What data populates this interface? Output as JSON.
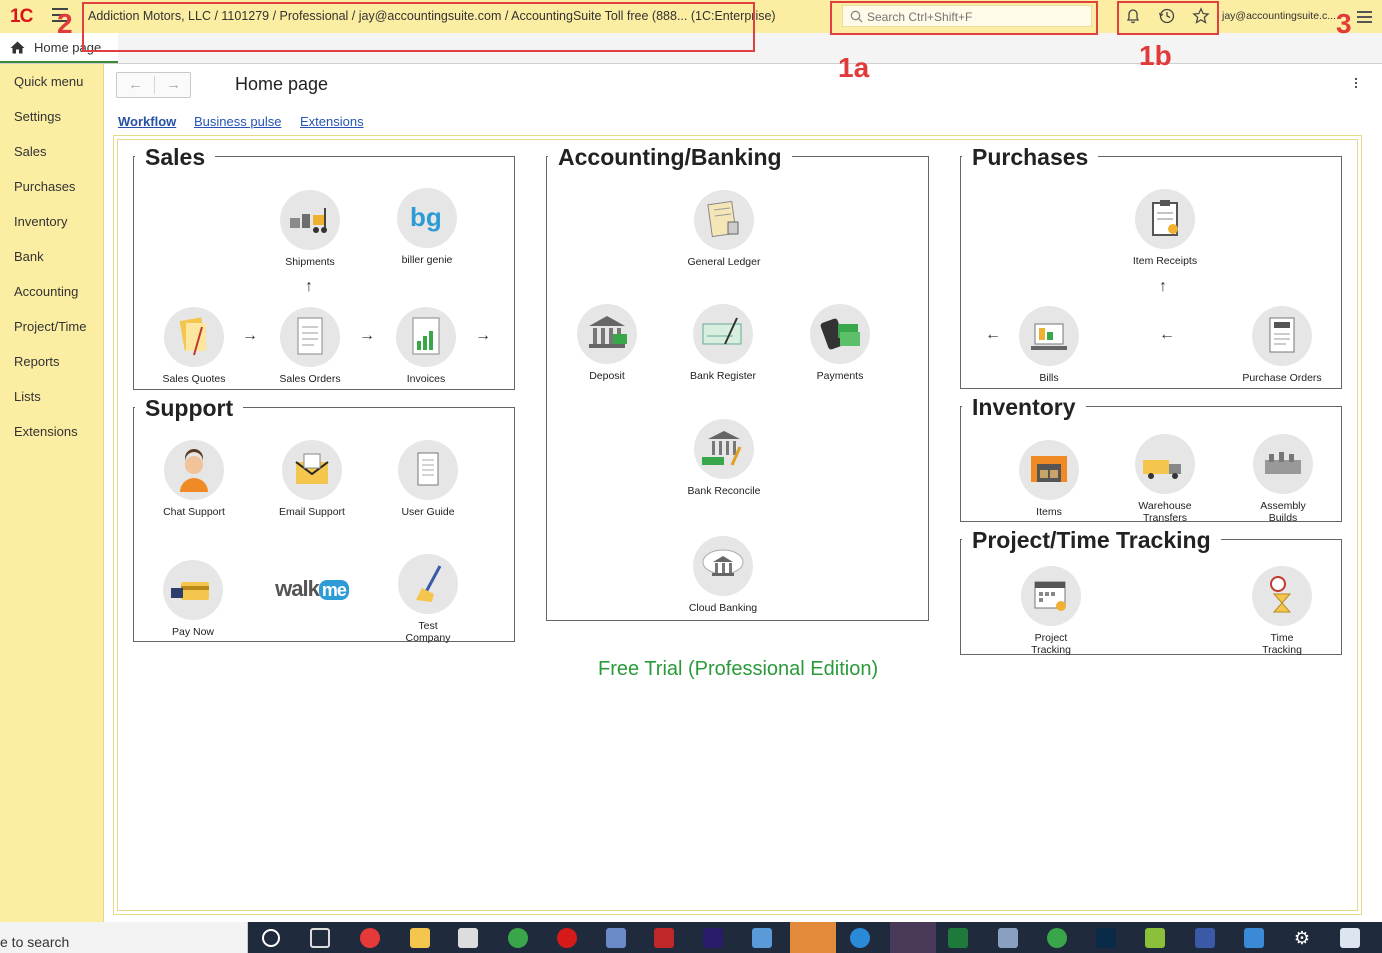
{
  "window": {
    "logo": "1С",
    "title": "Addiction Motors, LLC / 1101279 / Professional / jay@accountingsuite.com / AccountingSuite Toll free (888...   (1C:Enterprise)",
    "user": "jay@accountingsuite.c..."
  },
  "search": {
    "placeholder": "Search Ctrl+Shift+F"
  },
  "annotations": {
    "label_1a": "1a",
    "label_1b": "1b",
    "label_2": "2",
    "label_3": "3",
    "color": "#e03a3a"
  },
  "tab": {
    "home_label": "Home page"
  },
  "sidebar": {
    "items": [
      {
        "label": "Quick menu"
      },
      {
        "label": "Settings"
      },
      {
        "label": "Sales"
      },
      {
        "label": "Purchases"
      },
      {
        "label": "Inventory"
      },
      {
        "label": "Bank"
      },
      {
        "label": "Accounting"
      },
      {
        "label": "Project/Time"
      },
      {
        "label": "Reports"
      },
      {
        "label": "Lists"
      },
      {
        "label": "Extensions"
      }
    ]
  },
  "page": {
    "title": "Home page",
    "nav_back": "←",
    "nav_forward": "→",
    "tabs": [
      {
        "label": "Workflow"
      },
      {
        "label": "Business pulse"
      },
      {
        "label": "Extensions"
      }
    ]
  },
  "groups": {
    "sales": {
      "title": "Sales",
      "shipments": "Shipments",
      "biller_genie": "biller genie",
      "sales_quotes": "Sales Quotes",
      "sales_orders": "Sales Orders",
      "invoices": "Invoices"
    },
    "support": {
      "title": "Support",
      "chat_support": "Chat Support",
      "email_support": "Email Support",
      "user_guide": "User Guide",
      "pay_now": "Pay Now",
      "walkme": "walk",
      "walkme_me": "me",
      "test_company": "Test\nCompany"
    },
    "accounting": {
      "title": "Accounting/Banking",
      "general_ledger": "General Ledger",
      "deposit": "Deposit",
      "bank_register": "Bank Register",
      "payments": "Payments",
      "bank_reconcile": "Bank Reconcile",
      "cloud_banking": "Cloud Banking"
    },
    "purchases": {
      "title": "Purchases",
      "item_receipts": "Item Receipts",
      "bills": "Bills",
      "purchase_orders": "Purchase Orders"
    },
    "inventory": {
      "title": "Inventory",
      "items": "Items",
      "warehouse_transfers": "Warehouse\nTransfers",
      "assembly_builds": "Assembly\nBuilds"
    },
    "project": {
      "title": "Project/Time Tracking",
      "project_tracking": "Project\nTracking",
      "time_tracking": "Time\nTracking"
    }
  },
  "footer": {
    "free_trial": "Free Trial (Professional Edition)"
  },
  "taskbar": {
    "search_text": "e to search"
  },
  "colors": {
    "accent_yellow": "#fbeda2",
    "link_blue": "#2754b4",
    "trial_green": "#2a9a3a"
  }
}
